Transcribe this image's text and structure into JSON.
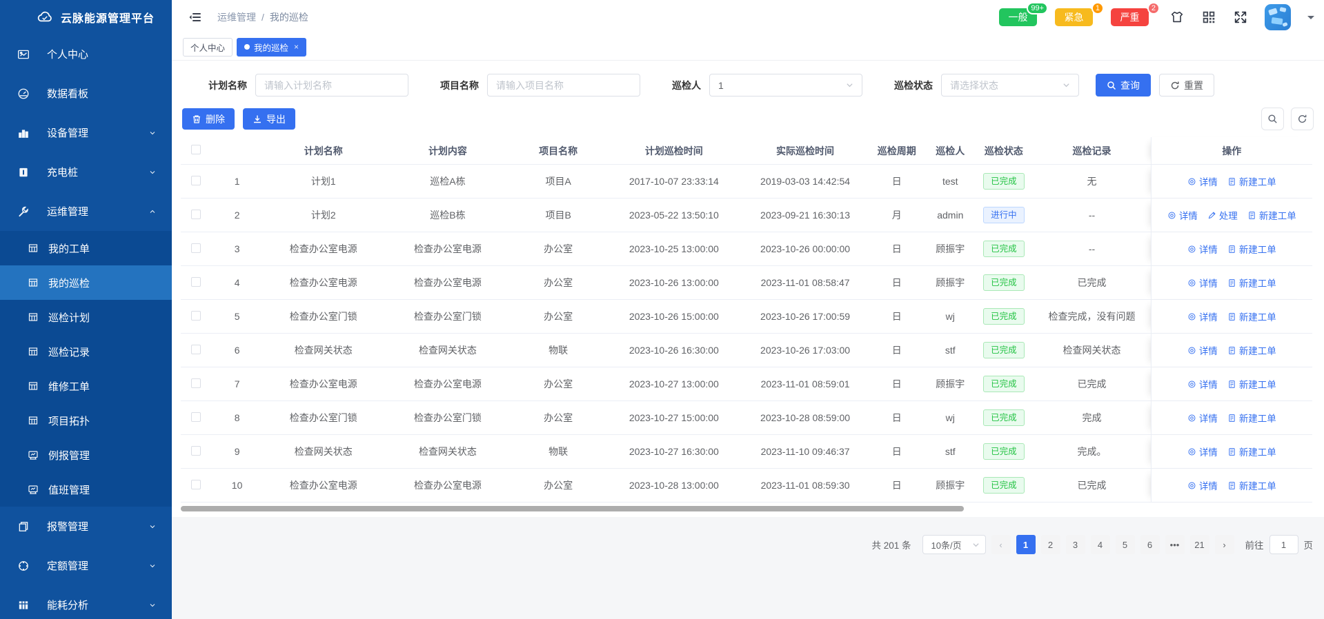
{
  "app": {
    "title": "云脉能源管理平台"
  },
  "sidebar": {
    "menu": [
      {
        "label": "个人中心",
        "icon": "user-card-icon",
        "type": "item"
      },
      {
        "label": "数据看板",
        "icon": "dashboard-icon",
        "type": "item"
      },
      {
        "label": "设备管理",
        "icon": "bar-chart-icon",
        "type": "item",
        "chevron": "down"
      },
      {
        "label": "充电桩",
        "icon": "charging-pile-icon",
        "type": "item",
        "chevron": "down"
      },
      {
        "label": "运维管理",
        "icon": "operations-icon",
        "type": "item",
        "chevron": "up"
      },
      {
        "label": "我的工单",
        "icon": "grid-icon",
        "type": "sub"
      },
      {
        "label": "我的巡检",
        "icon": "grid-icon",
        "type": "sub",
        "active": true
      },
      {
        "label": "巡检计划",
        "icon": "grid-icon",
        "type": "sub"
      },
      {
        "label": "巡检记录",
        "icon": "grid-icon",
        "type": "sub"
      },
      {
        "label": "维修工单",
        "icon": "grid-icon",
        "type": "sub"
      },
      {
        "label": "项目拓扑",
        "icon": "grid-icon",
        "type": "sub"
      },
      {
        "label": "例报管理",
        "icon": "monitor-icon",
        "type": "sub"
      },
      {
        "label": "值班管理",
        "icon": "monitor-icon",
        "type": "sub"
      },
      {
        "label": "报警管理",
        "icon": "alarm-file-icon",
        "type": "item",
        "chevron": "down"
      },
      {
        "label": "定额管理",
        "icon": "quota-icon",
        "type": "item",
        "chevron": "down"
      },
      {
        "label": "能耗分析",
        "icon": "energy-icon",
        "type": "item",
        "chevron": "down"
      }
    ]
  },
  "header": {
    "breadcrumb": [
      "运维管理",
      "我的巡检"
    ],
    "breadcrumb_sep": "/",
    "alerts": [
      {
        "label": "一般",
        "count": "99+",
        "color": "#22c55e",
        "badge_color": "#22c55e"
      },
      {
        "label": "紧急",
        "count": "1",
        "color": "#f7ba1e",
        "badge_color": "#f90"
      },
      {
        "label": "严重",
        "count": "2",
        "color": "#f5433f",
        "badge_color": "#f56c6c"
      }
    ]
  },
  "tabs": [
    {
      "label": "个人中心",
      "active": false
    },
    {
      "label": "我的巡检",
      "active": true,
      "closable": true
    }
  ],
  "filters": {
    "plan_name": {
      "label": "计划名称",
      "placeholder": "请输入计划名称",
      "value": ""
    },
    "project_name": {
      "label": "项目名称",
      "placeholder": "请输入项目名称",
      "value": ""
    },
    "inspector": {
      "label": "巡检人",
      "value": "1"
    },
    "status": {
      "label": "巡检状态",
      "placeholder": "请选择状态",
      "value": ""
    },
    "search_label": "查询",
    "reset_label": "重置"
  },
  "toolbar": {
    "delete_label": "删除",
    "export_label": "导出"
  },
  "table": {
    "columns": [
      "",
      "",
      "计划名称",
      "计划内容",
      "项目名称",
      "计划巡检时间",
      "实际巡检时间",
      "巡检周期",
      "巡检人",
      "巡检状态",
      "巡检记录",
      "操作"
    ],
    "rows": [
      {
        "no": "1",
        "plan_name": "计划1",
        "plan_content": "巡检A栋",
        "project": "项目A",
        "plan_time": "2017-10-07 23:33:14",
        "actual_time": "2019-03-03 14:42:54",
        "cycle": "日",
        "inspector": "test",
        "status": "已完成",
        "record": "无",
        "actions": [
          {
            "label": "详情",
            "icon": "eye-icon"
          },
          {
            "label": "新建工单",
            "icon": "doc-icon"
          }
        ]
      },
      {
        "no": "2",
        "plan_name": "计划2",
        "plan_content": "巡检B栋",
        "project": "项目B",
        "plan_time": "2023-05-22 13:50:10",
        "actual_time": "2023-09-21 16:30:13",
        "cycle": "月",
        "inspector": "admin",
        "status": "进行中",
        "record": "--",
        "actions": [
          {
            "label": "详情",
            "icon": "eye-icon"
          },
          {
            "label": "处理",
            "icon": "pen-icon"
          },
          {
            "label": "新建工单",
            "icon": "doc-icon"
          }
        ]
      },
      {
        "no": "3",
        "plan_name": "检查办公室电源",
        "plan_content": "检查办公室电源",
        "project": "办公室",
        "plan_time": "2023-10-25 13:00:00",
        "actual_time": "2023-10-26 00:00:00",
        "cycle": "日",
        "inspector": "顾振宇",
        "status": "已完成",
        "record": "--",
        "actions": [
          {
            "label": "详情",
            "icon": "eye-icon"
          },
          {
            "label": "新建工单",
            "icon": "doc-icon"
          }
        ]
      },
      {
        "no": "4",
        "plan_name": "检查办公室电源",
        "plan_content": "检查办公室电源",
        "project": "办公室",
        "plan_time": "2023-10-26 13:00:00",
        "actual_time": "2023-11-01 08:58:47",
        "cycle": "日",
        "inspector": "顾振宇",
        "status": "已完成",
        "record": "已完成",
        "actions": [
          {
            "label": "详情",
            "icon": "eye-icon"
          },
          {
            "label": "新建工单",
            "icon": "doc-icon"
          }
        ]
      },
      {
        "no": "5",
        "plan_name": "检查办公室门锁",
        "plan_content": "检查办公室门锁",
        "project": "办公室",
        "plan_time": "2023-10-26 15:00:00",
        "actual_time": "2023-10-26 17:00:59",
        "cycle": "日",
        "inspector": "wj",
        "status": "已完成",
        "record": "检查完成，没有问题",
        "actions": [
          {
            "label": "详情",
            "icon": "eye-icon"
          },
          {
            "label": "新建工单",
            "icon": "doc-icon"
          }
        ]
      },
      {
        "no": "6",
        "plan_name": "检查网关状态",
        "plan_content": "检查网关状态",
        "project": "物联",
        "plan_time": "2023-10-26 16:30:00",
        "actual_time": "2023-10-26 17:03:00",
        "cycle": "日",
        "inspector": "stf",
        "status": "已完成",
        "record": "检查网关状态",
        "actions": [
          {
            "label": "详情",
            "icon": "eye-icon"
          },
          {
            "label": "新建工单",
            "icon": "doc-icon"
          }
        ]
      },
      {
        "no": "7",
        "plan_name": "检查办公室电源",
        "plan_content": "检查办公室电源",
        "project": "办公室",
        "plan_time": "2023-10-27 13:00:00",
        "actual_time": "2023-11-01 08:59:01",
        "cycle": "日",
        "inspector": "顾振宇",
        "status": "已完成",
        "record": "已完成",
        "actions": [
          {
            "label": "详情",
            "icon": "eye-icon"
          },
          {
            "label": "新建工单",
            "icon": "doc-icon"
          }
        ]
      },
      {
        "no": "8",
        "plan_name": "检查办公室门锁",
        "plan_content": "检查办公室门锁",
        "project": "办公室",
        "plan_time": "2023-10-27 15:00:00",
        "actual_time": "2023-10-28 08:59:00",
        "cycle": "日",
        "inspector": "wj",
        "status": "已完成",
        "record": "完成",
        "actions": [
          {
            "label": "详情",
            "icon": "eye-icon"
          },
          {
            "label": "新建工单",
            "icon": "doc-icon"
          }
        ]
      },
      {
        "no": "9",
        "plan_name": "检查网关状态",
        "plan_content": "检查网关状态",
        "project": "物联",
        "plan_time": "2023-10-27 16:30:00",
        "actual_time": "2023-11-10 09:46:37",
        "cycle": "日",
        "inspector": "stf",
        "status": "已完成",
        "record": "完成。",
        "actions": [
          {
            "label": "详情",
            "icon": "eye-icon"
          },
          {
            "label": "新建工单",
            "icon": "doc-icon"
          }
        ]
      },
      {
        "no": "10",
        "plan_name": "检查办公室电源",
        "plan_content": "检查办公室电源",
        "project": "办公室",
        "plan_time": "2023-10-28 13:00:00",
        "actual_time": "2023-11-01 08:59:30",
        "cycle": "日",
        "inspector": "顾振宇",
        "status": "已完成",
        "record": "已完成",
        "actions": [
          {
            "label": "详情",
            "icon": "eye-icon"
          },
          {
            "label": "新建工单",
            "icon": "doc-icon"
          }
        ]
      }
    ],
    "status_colors": {
      "done": "#23c343",
      "progress": "#3570f0"
    }
  },
  "pagination": {
    "total_label": "共 201 条",
    "page_size": "10条/页",
    "pages": [
      "1",
      "2",
      "3",
      "4",
      "5",
      "6",
      "•••",
      "21"
    ],
    "active_page": "1",
    "goto_label": "前往",
    "goto_value": "1",
    "page_unit": "页"
  },
  "accent_color": "#3570f0",
  "sidebar_color": "#10529e"
}
